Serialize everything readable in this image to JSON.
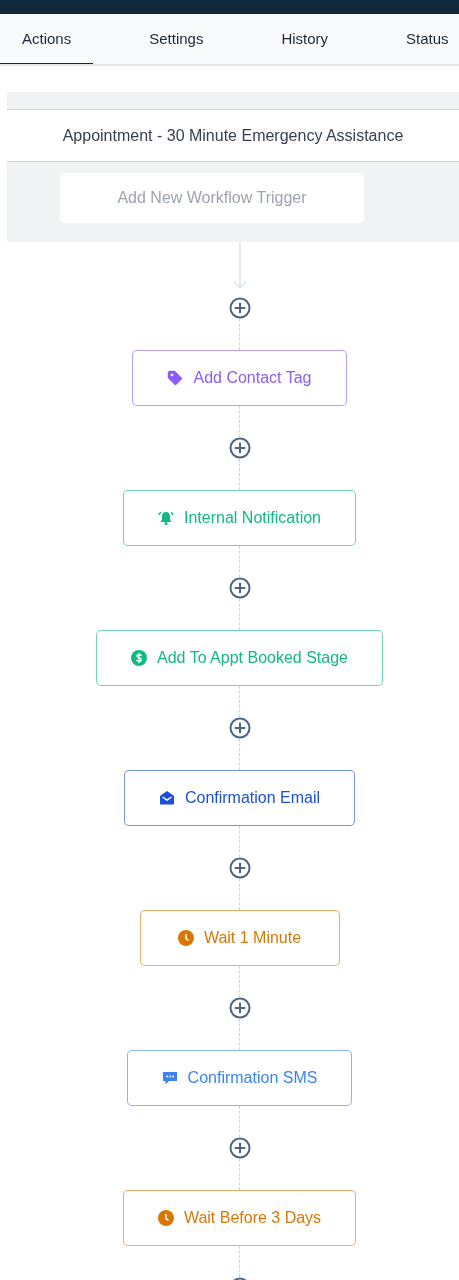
{
  "tabs": [
    {
      "label": "Actions",
      "selected": true
    },
    {
      "label": "Settings",
      "selected": false
    },
    {
      "label": "History",
      "selected": false
    },
    {
      "label": "Status",
      "selected": false
    }
  ],
  "workflow_title": "Appointment - 30 Minute Emergency Assistance",
  "trigger_button": "Add New Workflow Trigger",
  "steps": [
    {
      "kind": "tag",
      "label": "Add Contact Tag",
      "color": "#8b5cf6"
    },
    {
      "kind": "notification",
      "label": "Internal Notification",
      "color": "#10b981"
    },
    {
      "kind": "stage",
      "label": "Add To Appt Booked Stage",
      "color": "#10b981"
    },
    {
      "kind": "email",
      "label": "Confirmation Email",
      "color": "#1d4ed8"
    },
    {
      "kind": "wait",
      "label": "Wait 1 Minute",
      "color": "#d97706"
    },
    {
      "kind": "sms",
      "label": "Confirmation SMS",
      "color": "#3b82f6"
    },
    {
      "kind": "wait",
      "label": "Wait Before 3 Days",
      "color": "#d97706"
    }
  ]
}
